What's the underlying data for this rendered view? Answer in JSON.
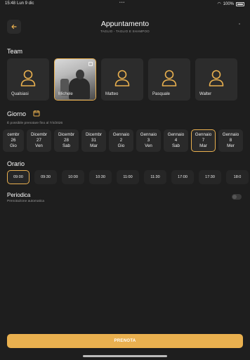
{
  "status": {
    "time": "15:48",
    "date": "Lun 9 dic",
    "battery": "100%"
  },
  "header": {
    "title": "Appuntamento",
    "subtitle": "TAGLIO - TAGLIO E SHAMPOO"
  },
  "team": {
    "title": "Team",
    "members": [
      {
        "name": "Qualsiasi",
        "photo": false,
        "selected": false
      },
      {
        "name": "Michele",
        "photo": true,
        "selected": true
      },
      {
        "name": "Matteo",
        "photo": false,
        "selected": false
      },
      {
        "name": "Pasquale",
        "photo": false,
        "selected": false
      },
      {
        "name": "Walter",
        "photo": false,
        "selected": false
      }
    ]
  },
  "giorno": {
    "title": "Giorno",
    "hint": "È possibile prenotare fino al 7/4/2026",
    "days": [
      {
        "month": "cembr",
        "day": "26",
        "weekday": "Gio",
        "selected": false
      },
      {
        "month": "Dicembr",
        "day": "27",
        "weekday": "Ven",
        "selected": false
      },
      {
        "month": "Dicembr",
        "day": "28",
        "weekday": "Sab",
        "selected": false
      },
      {
        "month": "Dicembr",
        "day": "31",
        "weekday": "Mar",
        "selected": false
      },
      {
        "month": "Gennaio",
        "day": "2",
        "weekday": "Gio",
        "selected": false
      },
      {
        "month": "Gennaio",
        "day": "3",
        "weekday": "Ven",
        "selected": false
      },
      {
        "month": "Gennaio",
        "day": "4",
        "weekday": "Sab",
        "selected": false
      },
      {
        "month": "Gennaio",
        "day": "7",
        "weekday": "Mar",
        "selected": true
      },
      {
        "month": "Gennaio",
        "day": "8",
        "weekday": "Mer",
        "selected": false
      }
    ]
  },
  "orario": {
    "title": "Orario",
    "times": [
      {
        "label": "09:00",
        "selected": true
      },
      {
        "label": "09:30",
        "selected": false
      },
      {
        "label": "10:00",
        "selected": false
      },
      {
        "label": "10:30",
        "selected": false
      },
      {
        "label": "11:00",
        "selected": false
      },
      {
        "label": "11:30",
        "selected": false
      },
      {
        "label": "17:00",
        "selected": false
      },
      {
        "label": "17:30",
        "selected": false
      },
      {
        "label": "18:0",
        "selected": false
      }
    ]
  },
  "periodica": {
    "title": "Periodica",
    "subtitle": "Prenotazione automatica",
    "enabled": false
  },
  "cta": {
    "label": "PRENOTA"
  },
  "colors": {
    "accent": "#e9b04f",
    "background": "#1e1e1e",
    "card": "#2c2c2c"
  },
  "icons": {
    "back": "arrow-left-icon",
    "calendar": "calendar-icon",
    "person": "person-icon"
  }
}
